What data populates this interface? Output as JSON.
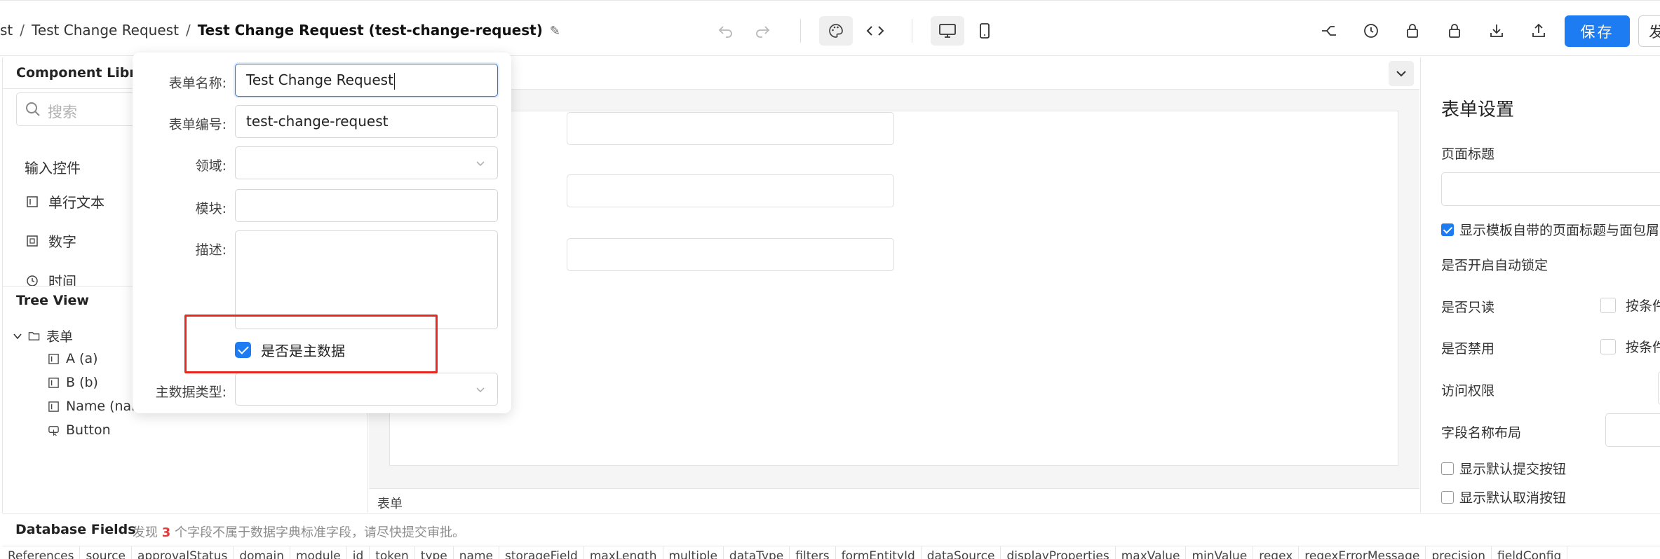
{
  "header": {
    "breadcrumb_prev": "st",
    "breadcrumb_parent": "Test Change Request",
    "breadcrumb_current": "Test Change Request (test-change-request)",
    "save_label": "保存",
    "next_label": "发"
  },
  "component_library": {
    "title": "Component Library",
    "search_placeholder": "搜索",
    "section_label": "输入控件",
    "items": [
      {
        "label": "单行文本",
        "icon": "text-field-icon"
      },
      {
        "label": "数字",
        "icon": "number-icon"
      },
      {
        "label": "时间",
        "icon": "clock-icon"
      }
    ]
  },
  "tree_view": {
    "title": "Tree View",
    "root_label": "表单",
    "children": [
      {
        "label": "A (a)",
        "icon": "text-field-icon"
      },
      {
        "label": "B (b)",
        "icon": "text-field-icon"
      },
      {
        "label": "Name (nam",
        "icon": "text-field-icon"
      },
      {
        "label": "Button",
        "icon": "button-icon"
      }
    ]
  },
  "canvas": {
    "footer_label": "表单"
  },
  "form_settings": {
    "title": "表单设置",
    "page_title_label": "页面标题",
    "show_template_title": "显示模板自带的页面标题与面包屑",
    "show_template_title_checked": true,
    "auto_lock_label": "是否开启自动锁定",
    "readonly_label": "是否只读",
    "readonly_cond": "按条件",
    "disabled_label": "是否禁用",
    "disabled_cond": "按条件",
    "access_label": "访问权限",
    "field_layout_label": "字段名称布局",
    "show_submit": "显示默认提交按钮",
    "show_cancel": "显示默认取消按钮"
  },
  "popover": {
    "name_label": "表单名称:",
    "name_value": "Test Change Request",
    "code_label": "表单编号:",
    "code_value": "test-change-request",
    "domain_label": "领域:",
    "module_label": "模块:",
    "desc_label": "描述:",
    "master_checkbox_label": "是否是主数据",
    "master_checked": true,
    "master_type_label": "主数据类型:"
  },
  "database_fields": {
    "title": "Database Fields",
    "msg_prefix": "发现",
    "count": "3",
    "msg_suffix": "个字段不属于数据字典标准字段，请尽快提交审批。",
    "columns": [
      "References",
      "source",
      "approvalStatus",
      "domain",
      "module",
      "id",
      "token",
      "type",
      "name",
      "storageField",
      "maxLength",
      "multiple",
      "dataType",
      "filters",
      "formEntityId",
      "dataSource",
      "displayProperties",
      "maxValue",
      "minValue",
      "regex",
      "regexErrorMessage",
      "precision",
      "fieldConfig"
    ]
  },
  "colors": {
    "accent": "#1d7cf2",
    "highlight": "#e8281f",
    "count_red": "#e23b3b"
  }
}
